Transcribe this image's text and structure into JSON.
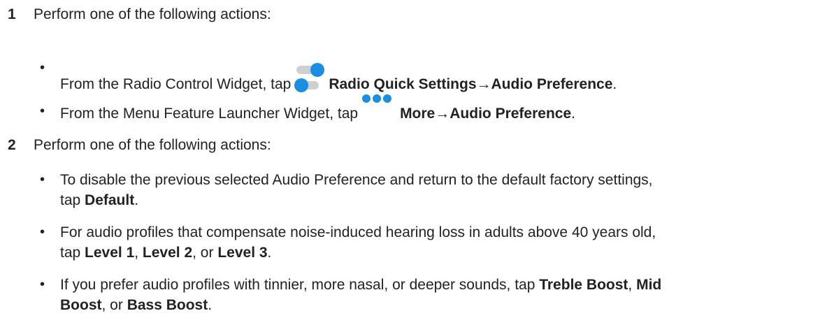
{
  "step1": {
    "number": "1",
    "intro": "Perform one of the following actions:",
    "items": [
      {
        "bullet": "•",
        "prefix": "From the Radio Control Widget, tap",
        "icon": "toggle-icon",
        "bold1": "Radio Quick Settings",
        "arrow": "→",
        "bold2": "Audio Preference",
        "suffix": "."
      },
      {
        "bullet": "•",
        "prefix": "From the Menu Feature Launcher Widget, tap",
        "icon": "more-dots-icon",
        "bold1": "More",
        "arrow": "→",
        "bold2": "Audio Preference",
        "suffix": "."
      }
    ]
  },
  "step2": {
    "number": "2",
    "intro": "Perform one of the following actions:",
    "items": [
      {
        "bullet": "•",
        "line1": "To disable the previous selected Audio Preference and return to the default factory settings,",
        "prefix": "tap ",
        "bold1": "Default",
        "suffix": "."
      },
      {
        "bullet": "•",
        "line1": "For audio profiles that compensate noise-induced hearing loss in adults above 40 years old,",
        "prefix": "tap ",
        "bold1": "Level 1",
        "sep1": ", ",
        "bold2": "Level 2",
        "sep2": ", or ",
        "bold3": "Level 3",
        "suffix": "."
      },
      {
        "bullet": "•",
        "line1_text": "If you prefer audio profiles with tinnier, more nasal, or deeper sounds, tap ",
        "bold1": "Treble Boost",
        "sep1": ", ",
        "bold2a": "Mid",
        "bold2b": "Boost",
        "sep2": ", or ",
        "bold3": "Bass Boost",
        "suffix": "."
      }
    ]
  },
  "colors": {
    "text": "#222222",
    "icon_accent": "#1a8ee0",
    "icon_track": "#cfcfcf"
  }
}
